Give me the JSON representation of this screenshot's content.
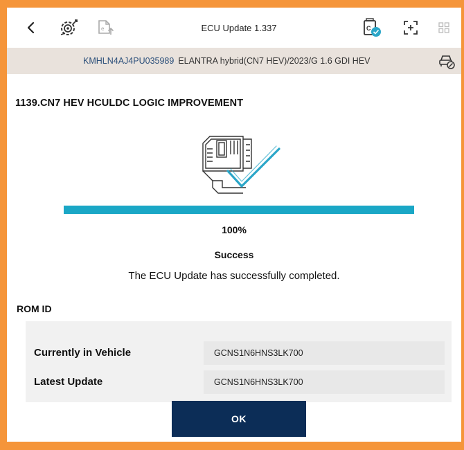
{
  "toolbar": {
    "title": "ECU Update 1.337",
    "icons": [
      "back-chevron-icon",
      "diagnostic-gear-icon",
      "ecu-upload-icon",
      "battery-status-icon",
      "screen-capture-icon",
      "grid-menu-icon"
    ]
  },
  "vehicle": {
    "vin": "KMHLN4AJ4PU035989",
    "description": "ELANTRA hybrid(CN7 HEV)/2023/G 1.6 GDI HEV"
  },
  "job": {
    "title": "1139.CN7 HEV HCULDC LOGIC IMPROVEMENT"
  },
  "progress": {
    "value": 100,
    "label": "100%"
  },
  "status": {
    "title": "Success",
    "message": "The ECU Update has successfully completed."
  },
  "rom": {
    "label": "ROM ID",
    "rows": [
      {
        "key": "Currently in Vehicle",
        "value": "GCNS1N6HNS3LK700"
      },
      {
        "key": "Latest Update",
        "value": "GCNS1N6HNS3LK700"
      }
    ]
  },
  "actions": {
    "ok_label": "OK"
  },
  "colors": {
    "border": "#f5953a",
    "progress": "#1aa7c6",
    "button": "#0c2d57",
    "vehicle_bar": "#e9e2dc",
    "check": "#2aa6c8"
  }
}
